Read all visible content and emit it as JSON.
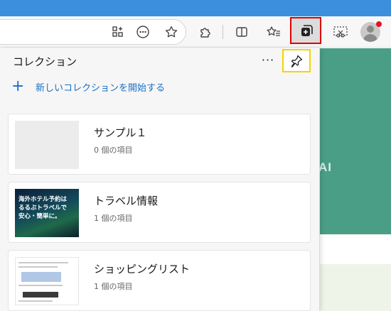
{
  "colors": {
    "titlebar": "#3c8fdc",
    "accent": "#1a6fc5",
    "highlight_red": "#e00000",
    "highlight_yellow": "#f2d600",
    "page_green": "#4a9e85"
  },
  "toolbar": {
    "icons": [
      "apps-icon",
      "reading-more-icon",
      "favorite-star-icon",
      "extensions-icon",
      "split-screen-icon",
      "favorites-list-icon",
      "collections-icon",
      "screenshot-icon",
      "profile-avatar-icon"
    ]
  },
  "background_page": {
    "hero_text": "AI"
  },
  "panel": {
    "title": "コレクション",
    "more_label": "···",
    "new_collection_label": "新しいコレクションを開始する",
    "collections": [
      {
        "name": "サンプル１",
        "count": "0 個の項目",
        "thumb": "empty"
      },
      {
        "name": "トラベル情報",
        "count": "1 個の項目",
        "thumb": "travel",
        "thumb_text": "海外ホテル予約は\nるるぶトラベルで\n安心・簡単に。"
      },
      {
        "name": "ショッピングリスト",
        "count": "1 個の項目",
        "thumb": "shopping"
      }
    ]
  }
}
